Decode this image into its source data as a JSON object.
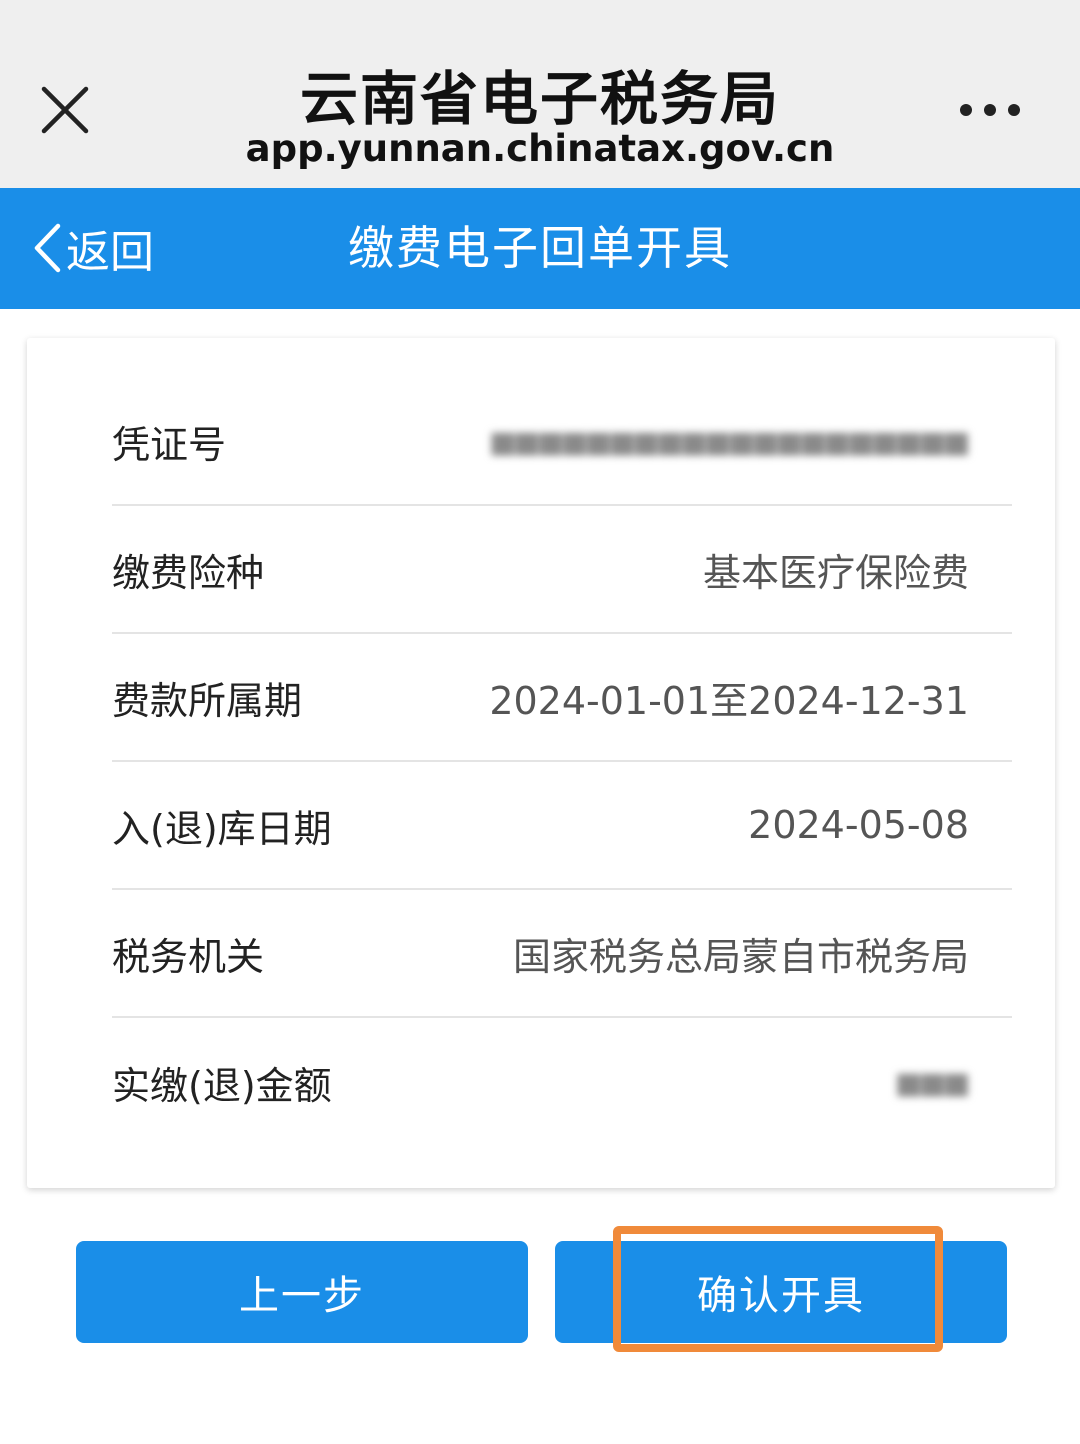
{
  "browser": {
    "site_title": "云南省电子税务局",
    "site_url": "app.yunnan.chinatax.gov.cn"
  },
  "nav": {
    "back_label": "返回",
    "title": "缴费电子回单开具"
  },
  "details": [
    {
      "label": "凭证号",
      "value": "",
      "blurred": true
    },
    {
      "label": "缴费险种",
      "value": "基本医疗保险费"
    },
    {
      "label": "费款所属期",
      "value": "2024-01-01至2024-12-31"
    },
    {
      "label": "入(退)库日期",
      "value": "2024-05-08"
    },
    {
      "label": "税务机关",
      "value": "国家税务总局蒙自市税务局"
    },
    {
      "label": "实缴(退)金额",
      "value": "",
      "blurred": true
    }
  ],
  "buttons": {
    "prev_label": "上一步",
    "confirm_label": "确认开具"
  },
  "colors": {
    "accent": "#1a8ee8",
    "highlight": "#f08a3a"
  }
}
